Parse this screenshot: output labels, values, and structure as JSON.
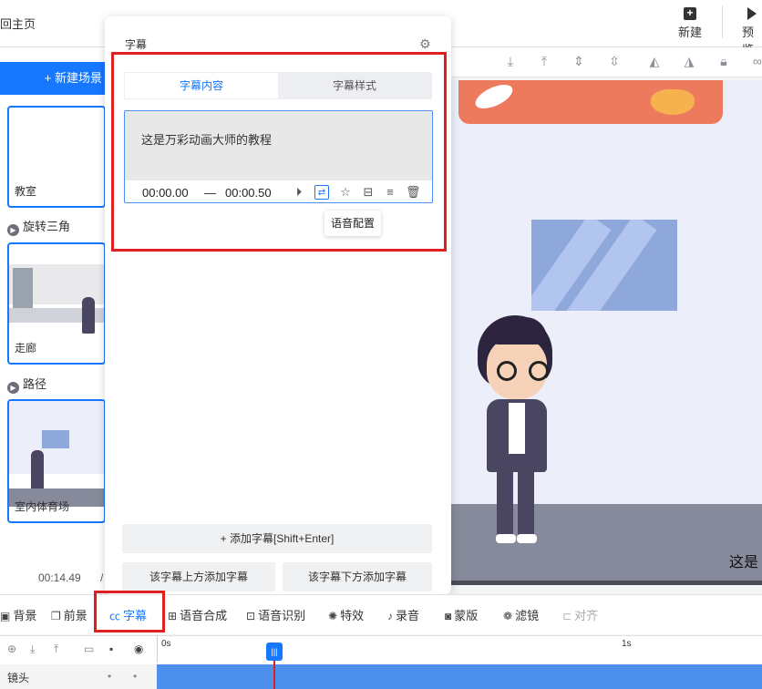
{
  "topbar": {
    "back_label": "回主页",
    "new_label": "新建",
    "preview_label": "预览"
  },
  "scenes": {
    "new_scene_label": "+ 新建场景",
    "items": [
      {
        "label": "教室"
      },
      {
        "label": "走廊"
      },
      {
        "label": "室内体育场"
      }
    ],
    "transitions": [
      "旋转三角",
      "路径"
    ],
    "time": "00:14.49",
    "time_sep": "/"
  },
  "panel": {
    "title": "字幕",
    "tabs": [
      {
        "label": "字幕内容",
        "active": true
      },
      {
        "label": "字幕样式",
        "active": false
      }
    ],
    "subtitle": {
      "text": "这是万彩动画大师的教程",
      "start": "00:00.00",
      "dash": "—",
      "end": "00:00.50"
    },
    "tooltip": "语音配置",
    "add_label": "+ 添加字幕[Shift+Enter]",
    "add_above_label": "该字幕上方添加字幕",
    "add_below_label": "该字幕下方添加字幕"
  },
  "canvas": {
    "subtitle_preview": "这是"
  },
  "toolbar": {
    "items": [
      {
        "label": "背景"
      },
      {
        "label": "前景"
      },
      {
        "label": "字幕",
        "active": true
      },
      {
        "label": "语音合成"
      },
      {
        "label": "语音识别"
      },
      {
        "label": "特效"
      },
      {
        "label": "录音"
      },
      {
        "label": "蒙版"
      },
      {
        "label": "滤镜"
      },
      {
        "label": "对齐",
        "disabled": true
      }
    ]
  },
  "timeline": {
    "ruler": [
      "0s",
      "1s"
    ],
    "lane_label": "镜头"
  },
  "colors": {
    "accent": "#1677ff",
    "highlight_box": "#e02020"
  }
}
